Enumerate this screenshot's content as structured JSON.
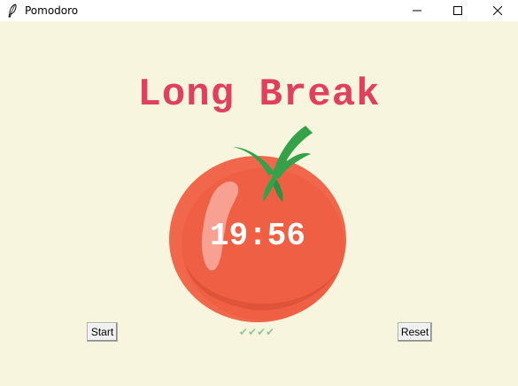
{
  "window": {
    "title": "Pomodoro"
  },
  "heading": "Long Break",
  "timer": "19:56",
  "buttons": {
    "start": "Start",
    "reset": "Reset"
  },
  "checkmarks": "✔✔✔✔",
  "colors": {
    "background": "#f7f5dd",
    "heading": "#e0405e",
    "checkmarks": "#8fc89a",
    "tomato": "#ef5f44",
    "leaf": "#35a24a"
  },
  "icons": {
    "app": "feather-icon",
    "minimize": "minimize-icon",
    "maximize": "maximize-icon",
    "close": "close-icon"
  }
}
